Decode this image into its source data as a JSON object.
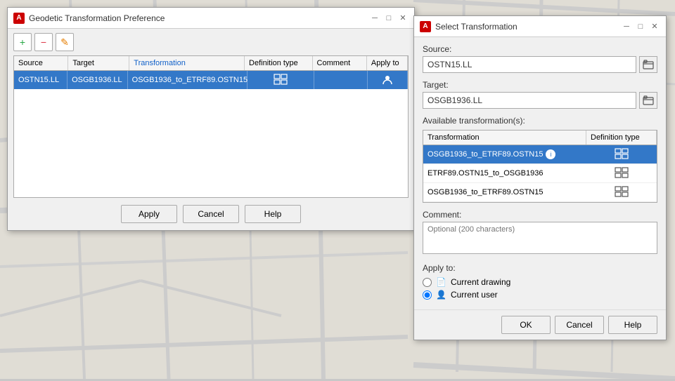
{
  "mapBg": {
    "description": "Street map background"
  },
  "mainDialog": {
    "title": "Geodetic Transformation Preference",
    "appIcon": "A",
    "toolbar": {
      "addBtn": "+",
      "removeBtn": "−",
      "editBtn": "✎"
    },
    "tableHeaders": {
      "source": "Source",
      "target": "Target",
      "transformation": "Transformation",
      "definitionType": "Definition type",
      "comment": "Comment",
      "applyTo": "Apply to"
    },
    "tableRows": [
      {
        "source": "OSTN15.LL",
        "target": "OSGB1936.LL",
        "transformation": "OSGB1936_to_ETRF89.OSTN15",
        "definitionType": "grid",
        "comment": "",
        "applyTo": "user"
      }
    ],
    "footer": {
      "apply": "Apply",
      "cancel": "Cancel",
      "help": "Help"
    }
  },
  "selectDialog": {
    "title": "Select Transformation",
    "appIcon": "A",
    "sourceLabel": "Source:",
    "sourceValue": "OSTN15.LL",
    "targetLabel": "Target:",
    "targetValue": "OSGB1936.LL",
    "availableLabel": "Available transformation(s):",
    "transformationHeader": "Transformation",
    "definitionTypeHeader": "Definition type",
    "transformations": [
      {
        "name": "OSGB1936_to_ETRF89.OSTN15",
        "definitionType": "grid",
        "selected": true,
        "hasInfo": true
      },
      {
        "name": "ETRF89.OSTN15_to_OSGB1936",
        "definitionType": "grid",
        "selected": false,
        "hasInfo": false
      },
      {
        "name": "OSGB1936_to_ETRF89.OSTN15",
        "definitionType": "grid",
        "selected": false,
        "hasInfo": false
      }
    ],
    "commentLabel": "Comment:",
    "commentPlaceholder": "Optional (200 characters)",
    "applyToLabel": "Apply to:",
    "applyOptions": [
      {
        "label": "Current drawing",
        "value": "drawing",
        "icon": "📄",
        "checked": false
      },
      {
        "label": "Current user",
        "value": "user",
        "icon": "👤",
        "checked": true
      }
    ],
    "footer": {
      "ok": "OK",
      "cancel": "Cancel",
      "help": "Help"
    }
  }
}
